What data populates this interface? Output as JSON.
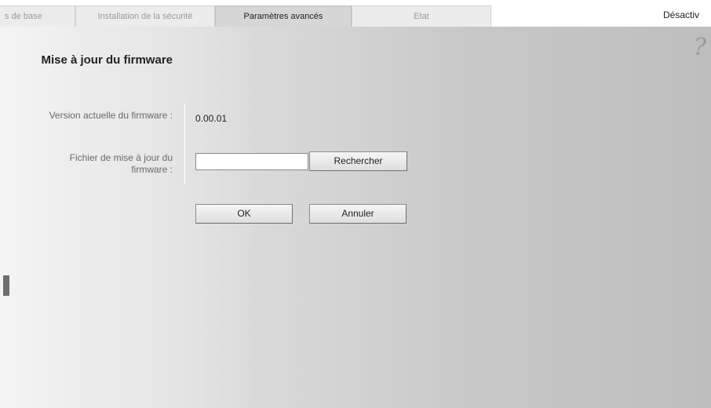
{
  "tabs": [
    {
      "label": "s de base",
      "active": false
    },
    {
      "label": "Installation de la sécurité",
      "active": false
    },
    {
      "label": "Paramètres avancés",
      "active": true
    },
    {
      "label": "Etat",
      "active": false
    }
  ],
  "header": {
    "logout_label": "Désactiv"
  },
  "help": {
    "icon": "question-mark-icon",
    "glyph": "?"
  },
  "form": {
    "title": "Mise à jour du firmware",
    "current_version_label": "Version actuelle du firmware :",
    "current_version_value": "0.00.01",
    "file_label": "Fichier de mise à jour du firmware :",
    "file_value": "",
    "browse_label": "Rechercher",
    "ok_label": "OK",
    "cancel_label": "Annuler"
  },
  "colors": {
    "active_tab": "#d6d6d6",
    "inactive_tab": "#ececec",
    "panel_light": "#f4f4f4",
    "panel_dark": "#bebebe"
  }
}
